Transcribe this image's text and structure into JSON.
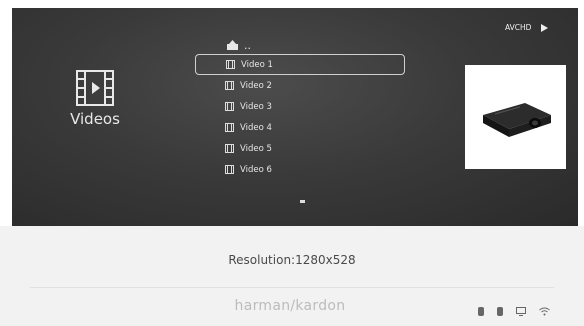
{
  "category": {
    "label": "Videos",
    "icon": "film-icon"
  },
  "list": {
    "up_label": "..",
    "items": [
      {
        "label": "Video 1",
        "selected": true
      },
      {
        "label": "Video 2"
      },
      {
        "label": "Video 3"
      },
      {
        "label": "Video 4"
      },
      {
        "label": "Video 5"
      },
      {
        "label": "Video 6"
      }
    ]
  },
  "header": {
    "format_label": "AVCHD"
  },
  "info": {
    "resolution": "Resolution:1280x528"
  },
  "footer": {
    "brand": "harman/kardon",
    "status_icons": [
      "bluetooth-icon",
      "bluetooth-icon",
      "display-icon",
      "wifi-icon"
    ]
  },
  "colors": {
    "background_dark": "#3a3a3a",
    "panel_light": "#f2f2f2",
    "text_light": "#e8e8e8"
  }
}
